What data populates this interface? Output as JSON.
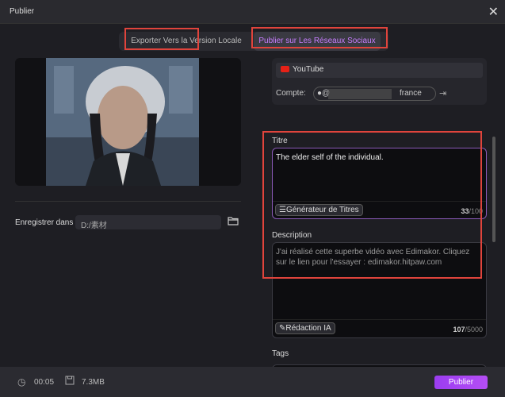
{
  "window": {
    "title": "Publier"
  },
  "tabs": [
    {
      "label": "Exporter Vers la Version Locale"
    },
    {
      "label": "Publier sur Les Réseaux Sociaux"
    }
  ],
  "left": {
    "save_label": "Enregistrer dans",
    "save_path": "D:/素材"
  },
  "platform": {
    "name": "YouTube",
    "account_label": "Compte:",
    "account_prefix": "@",
    "account_suffix": "france"
  },
  "titre": {
    "label": "Titre",
    "value": "The elder self of the individual.",
    "generator_label": "Générateur de Titres",
    "count": "33",
    "max": "/100"
  },
  "description": {
    "label": "Description",
    "value": "J'ai réalisé cette superbe vidéo avec Edimakor. Cliquez sur le lien pour l'essayer : edimakor.hitpaw.com",
    "ai_label": "Rédaction IA",
    "count": "107",
    "max": "/5000"
  },
  "tags": {
    "label": "Tags"
  },
  "footer": {
    "duration": "00:05",
    "size": "7.3MB",
    "publish_label": "Publier"
  },
  "colors": {
    "accent": "#b54ef5",
    "youtube": "#e62117",
    "annotation": "#e0443c"
  }
}
